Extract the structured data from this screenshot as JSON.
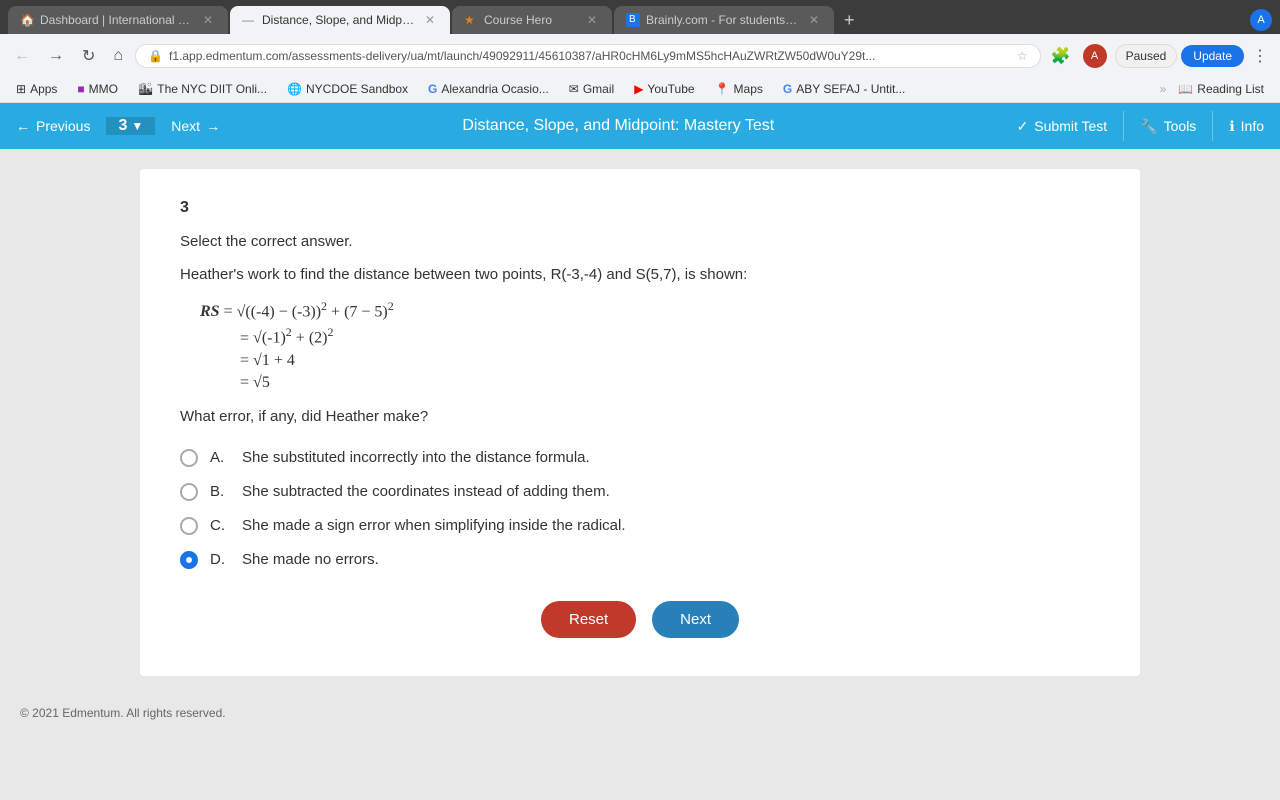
{
  "browser": {
    "tabs": [
      {
        "id": "tab1",
        "title": "Dashboard | International Virtu...",
        "favicon": "🏠",
        "active": false,
        "closable": true
      },
      {
        "id": "tab2",
        "title": "Distance, Slope, and Midpoint...",
        "favicon": "—",
        "active": true,
        "closable": true
      },
      {
        "id": "tab3",
        "title": "Course Hero",
        "favicon": "★",
        "active": false,
        "closable": true
      },
      {
        "id": "tab4",
        "title": "Brainly.com - For students. By...",
        "favicon": "B",
        "active": false,
        "closable": true
      }
    ],
    "url": "f1.app.edmentum.com/assessments-delivery/ua/mt/launch/49092911/45610387/aHR0cHM6Ly9mMS5hcHAuZWRtZW50dW0uY29t...",
    "paused_label": "Paused",
    "update_label": "Update"
  },
  "bookmarks": [
    {
      "label": "Apps",
      "icon": "⊞"
    },
    {
      "label": "MMO",
      "icon": "🟣"
    },
    {
      "label": "The NYC DIIT Onli...",
      "icon": "🏙"
    },
    {
      "label": "NYCDOE Sandbox",
      "icon": "🌐"
    },
    {
      "label": "Alexandria Ocasio...",
      "icon": "G"
    },
    {
      "label": "Gmail",
      "icon": "✉"
    },
    {
      "label": "YouTube",
      "icon": "▶"
    },
    {
      "label": "Maps",
      "icon": "📍"
    },
    {
      "label": "ABY SEFAJ - Untit...",
      "icon": "G"
    }
  ],
  "toolbar": {
    "previous_label": "Previous",
    "next_label": "Next",
    "question_number": "3",
    "title": "Distance, Slope, and Midpoint: Mastery Test",
    "submit_label": "Submit Test",
    "tools_label": "Tools",
    "info_label": "Info",
    "reading_list_label": "Reading List"
  },
  "question": {
    "number": "3",
    "prompt": "Select the correct answer.",
    "description": "Heather's work to find the distance between two points, R(-3,-4) and S(5,7), is shown:",
    "math_lines": [
      "RS = √((-4) − (-3))² + (7 − 5)²",
      "= √(-1)² + (2)²",
      "= √1 + 4",
      "= √5"
    ],
    "error_question": "What error, if any, did Heather make?",
    "options": [
      {
        "id": "A",
        "text": "She substituted incorrectly into the distance formula."
      },
      {
        "id": "B",
        "text": "She subtracted the coordinates instead of adding them."
      },
      {
        "id": "C",
        "text": "She made a sign error when simplifying inside the radical."
      },
      {
        "id": "D",
        "text": "She made no errors.",
        "selected": true
      }
    ],
    "reset_label": "Reset",
    "next_label": "Next"
  },
  "footer": {
    "copyright": "© 2021 Edmentum. All rights reserved."
  }
}
